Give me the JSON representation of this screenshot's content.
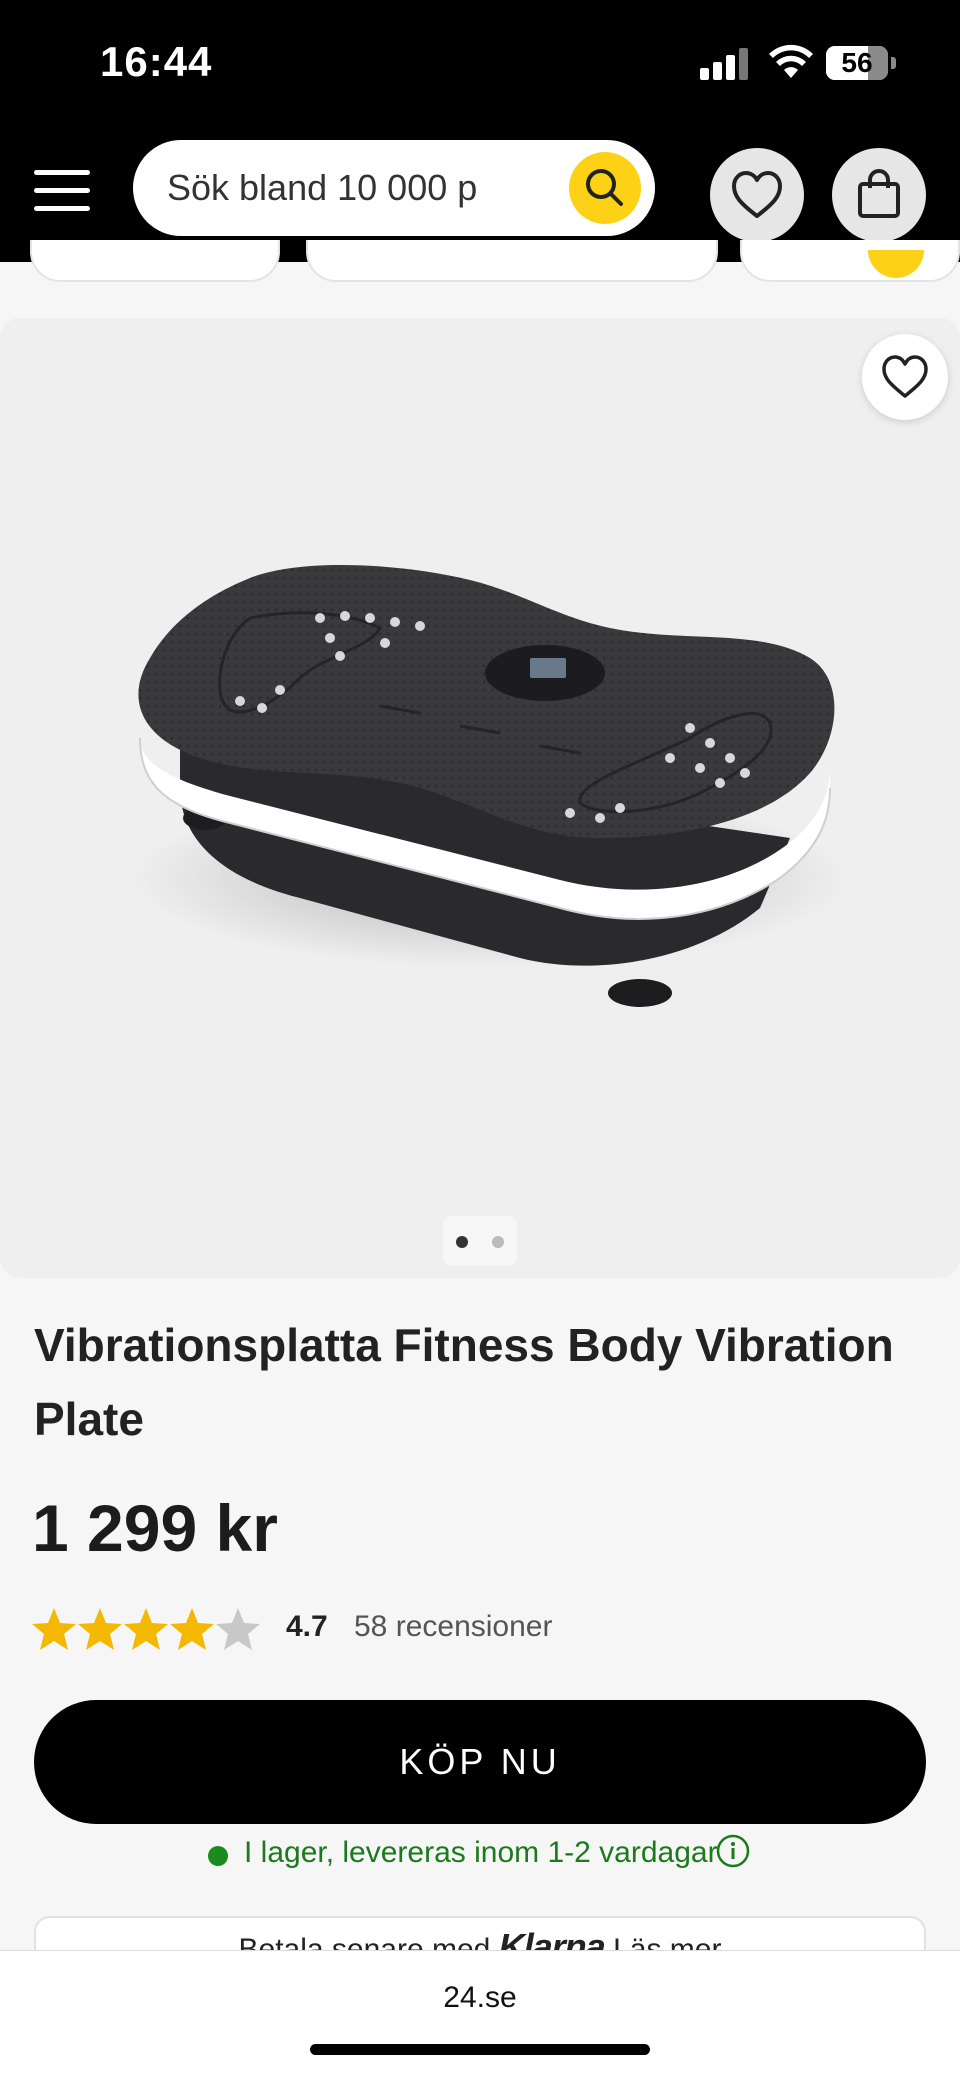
{
  "status_bar": {
    "time": "16:44",
    "battery": "56",
    "icons": [
      "cellular-signal-icon",
      "wifi-icon",
      "battery-icon"
    ]
  },
  "header": {
    "menu_icon": "hamburger-menu-icon",
    "search": {
      "placeholder": "Sök bland 10 000 p",
      "button_icon": "search-icon"
    },
    "wishlist_icon": "heart-icon",
    "cart_icon": "shopping-bag-icon"
  },
  "product": {
    "image_alt": "Vibrationsplatta",
    "favorite_icon": "heart-outline-icon",
    "carousel": {
      "count": 2,
      "active": 1
    },
    "title": "Vibrationsplatta Fitness Body Vibration Plate",
    "price": "1 299 kr",
    "rating": {
      "stars": 4.7,
      "value": "4.7",
      "reviews": "58 recensioner"
    },
    "buy_label": "KÖP NU",
    "stock_text": "I lager, levereras inom 1-2 vardagar",
    "klarna": {
      "prefix": "Betala senare med",
      "brand": "Klarna",
      "link": "Läs mer"
    }
  },
  "browser": {
    "url": "24.se"
  },
  "colors": {
    "accent_yellow": "#fcd116",
    "header_bg": "#000000",
    "stock_green": "#1b7a1b",
    "star_yellow": "#f5b800"
  }
}
